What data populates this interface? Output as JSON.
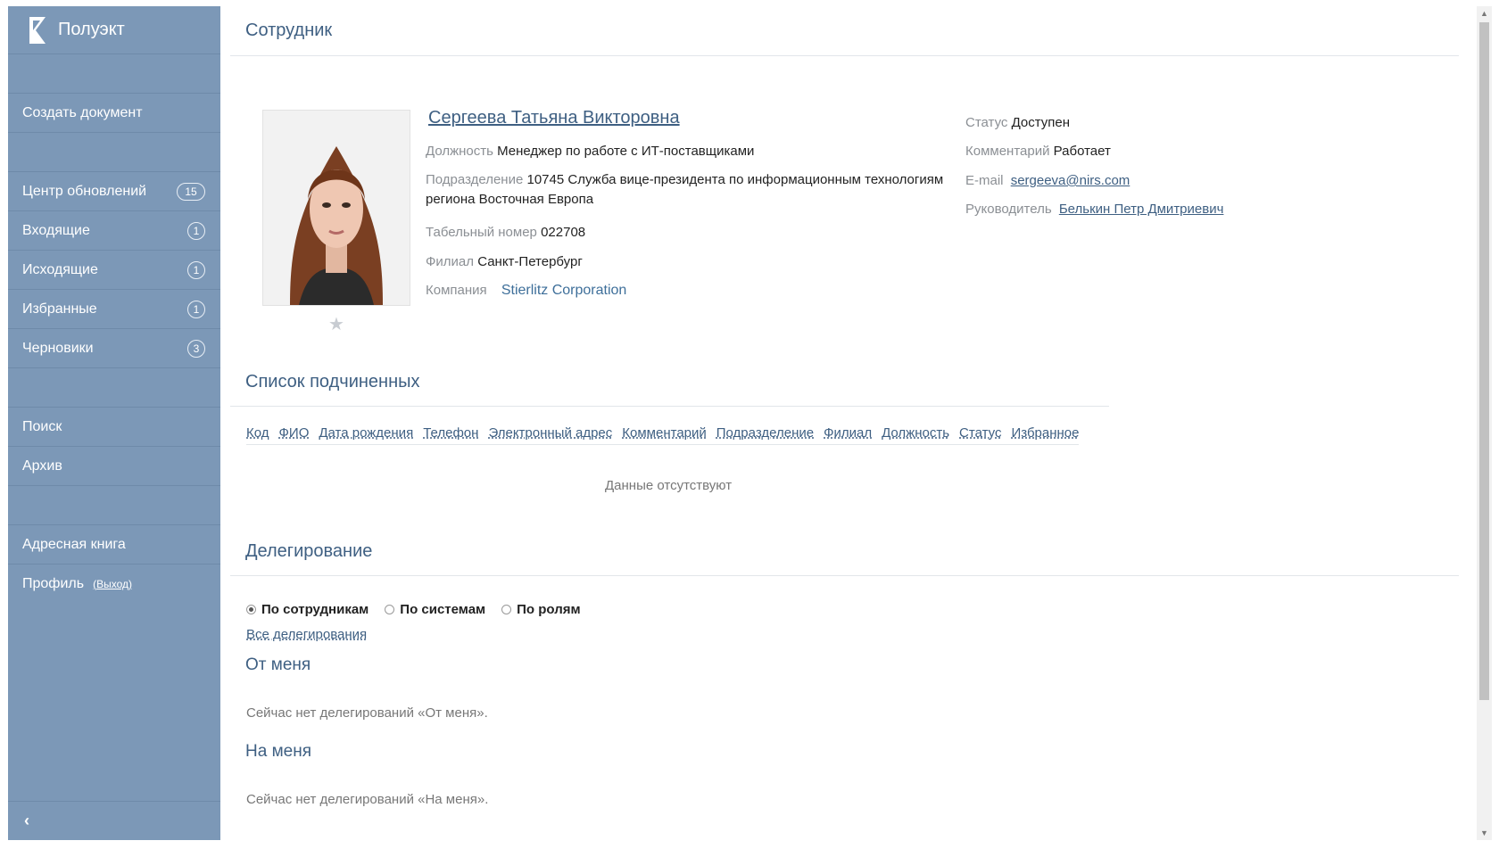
{
  "app": {
    "name": "Полуэкт"
  },
  "sidebar": {
    "create_doc": "Создать документ",
    "items": [
      {
        "label": "Центр обновлений",
        "badge": "15"
      },
      {
        "label": "Входящие",
        "badge": "1"
      },
      {
        "label": "Исходящие",
        "badge": "1"
      },
      {
        "label": "Избранные",
        "badge": "1"
      },
      {
        "label": "Черновики",
        "badge": "3"
      }
    ],
    "search": "Поиск",
    "archive": "Архив",
    "address_book": "Адресная книга",
    "profile": "Профиль",
    "logout": "(Выход)"
  },
  "page": {
    "title": "Сотрудник"
  },
  "employee": {
    "name": "Сергеева Татьяна Викторовна",
    "position_label": "Должность",
    "position": "Менеджер по работе с ИТ-поставщиками",
    "department_label": "Подразделение",
    "department": "10745 Служба вице-президента по информационным технологиям региона Восточная Европа",
    "tab_label": "Табельный номер",
    "tab_number": "022708",
    "branch_label": "Филиал",
    "branch": "Санкт-Петербург",
    "company_label": "Компания",
    "company": "Stierlitz Corporation",
    "status_label": "Статус",
    "status": "Доступен",
    "comment_label": "Комментарий",
    "comment": "Работает",
    "email_label": "E-mail",
    "email": "sergeeva@nirs.com",
    "manager_label": "Руководитель",
    "manager": "Белькин Петр Дмитриевич"
  },
  "subordinates": {
    "title": "Список подчиненных",
    "columns": [
      "Код",
      "ФИО",
      "Дата рождения",
      "Телефон",
      "Электронный адрес",
      "Комментарий",
      "Подразделение",
      "Филиал",
      "Должность",
      "Статус",
      "Избранное"
    ],
    "empty": "Данные отсутствуют"
  },
  "delegation": {
    "title": "Делегирование",
    "options": [
      "По сотрудникам",
      "По системам",
      "По ролям"
    ],
    "selected": "По сотрудникам",
    "all_link": "Все делегирования",
    "from_me_title": "От меня",
    "from_me_note": "Сейчас нет делегирований «От меня».",
    "to_me_title": "На меня",
    "to_me_note": "Сейчас нет делегирований «На меня»."
  }
}
